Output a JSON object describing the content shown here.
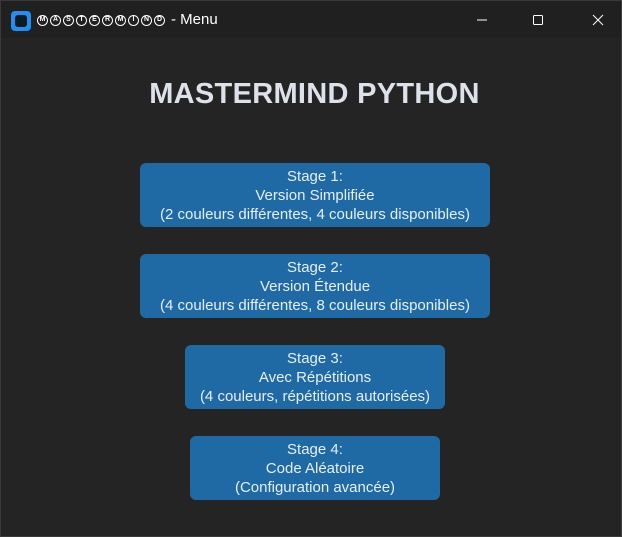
{
  "window": {
    "logo_text": "MASTERMIND",
    "title_suffix": "- Menu",
    "controls": {
      "minimize": "minimize-icon",
      "maximize": "maximize-icon",
      "close": "close-icon"
    }
  },
  "heading": "MASTERMIND PYTHON",
  "stages": [
    {
      "line1": "Stage 1:",
      "line2": "Version Simplifiée",
      "line3": "(2 couleurs différentes, 4 couleurs disponibles)"
    },
    {
      "line1": "Stage 2:",
      "line2": "Version Étendue",
      "line3": "(4 couleurs différentes, 8 couleurs disponibles)"
    },
    {
      "line1": "Stage 3:",
      "line2": "Avec Répétitions",
      "line3": "(4 couleurs, répétitions autorisées)"
    },
    {
      "line1": "Stage 4:",
      "line2": "Code Aléatoire",
      "line3": "(Configuration avancée)"
    }
  ],
  "colors": {
    "background": "#242424",
    "titlebar": "#202020",
    "button": "#1f6aa5",
    "heading": "#dde2ea",
    "app_icon": "#1f8ff0"
  }
}
